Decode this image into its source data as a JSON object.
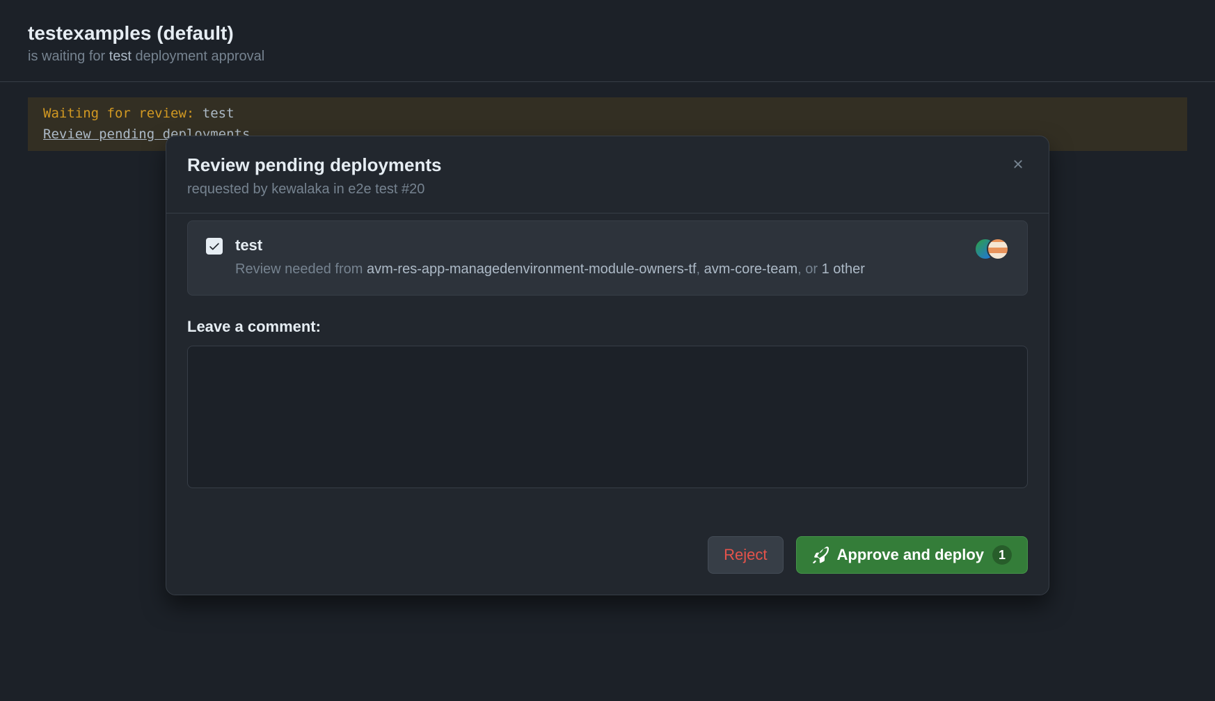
{
  "header": {
    "title": "testexamples (default)",
    "subtitle_prefix": "is waiting for ",
    "subtitle_env": "test",
    "subtitle_suffix": " deployment approval"
  },
  "log": {
    "label": "Waiting for review:",
    "env": "test",
    "link": "Review pending deployments"
  },
  "modal": {
    "title": "Review pending deployments",
    "subtitle": "requested by kewalaka in e2e test #20",
    "environment": {
      "name": "test",
      "checked": true,
      "review_prefix": "Review needed from ",
      "reviewer1": "avm-res-app-managedenvironment-module-owners-tf",
      "sep1": ", ",
      "reviewer2": "avm-core-team",
      "sep2": ", or ",
      "reviewer3": "1 other"
    },
    "comment": {
      "label": "Leave a comment:",
      "value": ""
    },
    "actions": {
      "reject": "Reject",
      "approve": "Approve and deploy",
      "approve_count": "1"
    }
  }
}
